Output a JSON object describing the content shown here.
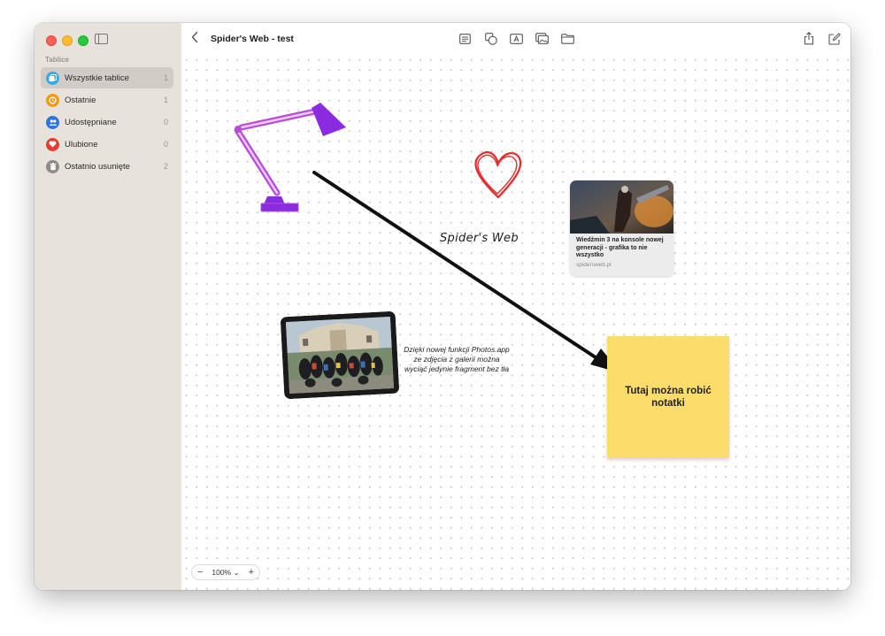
{
  "sidebar": {
    "section_title": "Tablice",
    "items": [
      {
        "label": "Wszystkie tablice",
        "count": "1",
        "icon": "boards-icon",
        "color": "#3aa9e8",
        "active": true
      },
      {
        "label": "Ostatnie",
        "count": "1",
        "icon": "clock-icon",
        "color": "#f29a12",
        "active": false
      },
      {
        "label": "Udostępniane",
        "count": "0",
        "icon": "people-icon",
        "color": "#2f74e0",
        "active": false
      },
      {
        "label": "Ulubione",
        "count": "0",
        "icon": "heart-icon",
        "color": "#e83b30",
        "active": false
      },
      {
        "label": "Ostatnio usunięte",
        "count": "2",
        "icon": "trash-icon",
        "color": "#8e8a86",
        "active": false
      }
    ]
  },
  "toolbar": {
    "title": "Spider's Web - test",
    "tools": [
      "note-tool-icon",
      "shapes-tool-icon",
      "textbox-tool-icon",
      "media-tool-icon",
      "folder-tool-icon"
    ],
    "right_tools": [
      "share-icon",
      "new-board-icon"
    ]
  },
  "canvas": {
    "handwriting": "Spider's Web",
    "link_card": {
      "title": "Wiedźmin 3 na konsole nowej generacji - grafika to nie wszystko",
      "domain": "spidersweb.pl"
    },
    "caption": "Dzięki nowej funkcji Photos.app ze zdjęcia z galerii można wyciąć jedynie fragment bez tła",
    "sticky_note": "Tutaj można robić notatki",
    "colors": {
      "lamp": "#b64dd9",
      "lamp_fill": "#8a2be2",
      "heart": "#e52b2b",
      "sticky": "#fcdc6a"
    }
  },
  "zoom": {
    "level": "100%",
    "minus": "−",
    "plus": "+",
    "chevron": "⌄"
  }
}
